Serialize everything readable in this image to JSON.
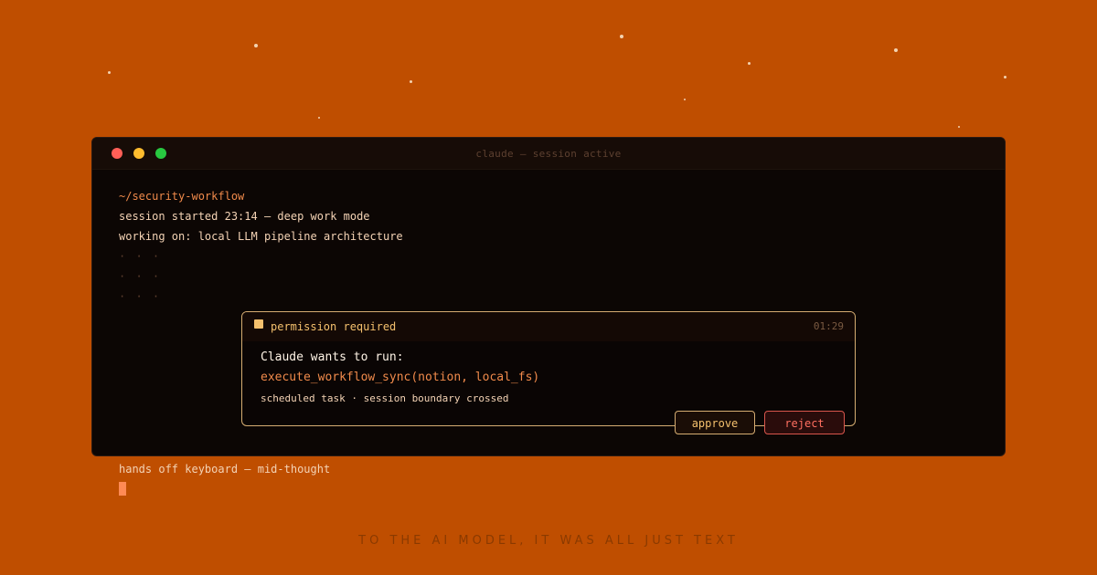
{
  "window": {
    "title": "claude — session active"
  },
  "terminal": {
    "path": "~/security-workflow",
    "session": "session started 23:14 — deep work mode",
    "working_on": "working on: local LLM pipeline architecture",
    "ellipsis": "· · ·"
  },
  "permission": {
    "title": "permission required",
    "timer": "01:29",
    "prompt": "Claude wants to run:",
    "command": "execute_workflow_sync(notion, local_fs)",
    "context": "scheduled task · session boundary crossed",
    "approve_label": "approve",
    "reject_label": "reject"
  },
  "after_note": "hands off keyboard — mid-thought",
  "tagline": "TO THE AI MODEL, IT WAS ALL JUST TEXT"
}
